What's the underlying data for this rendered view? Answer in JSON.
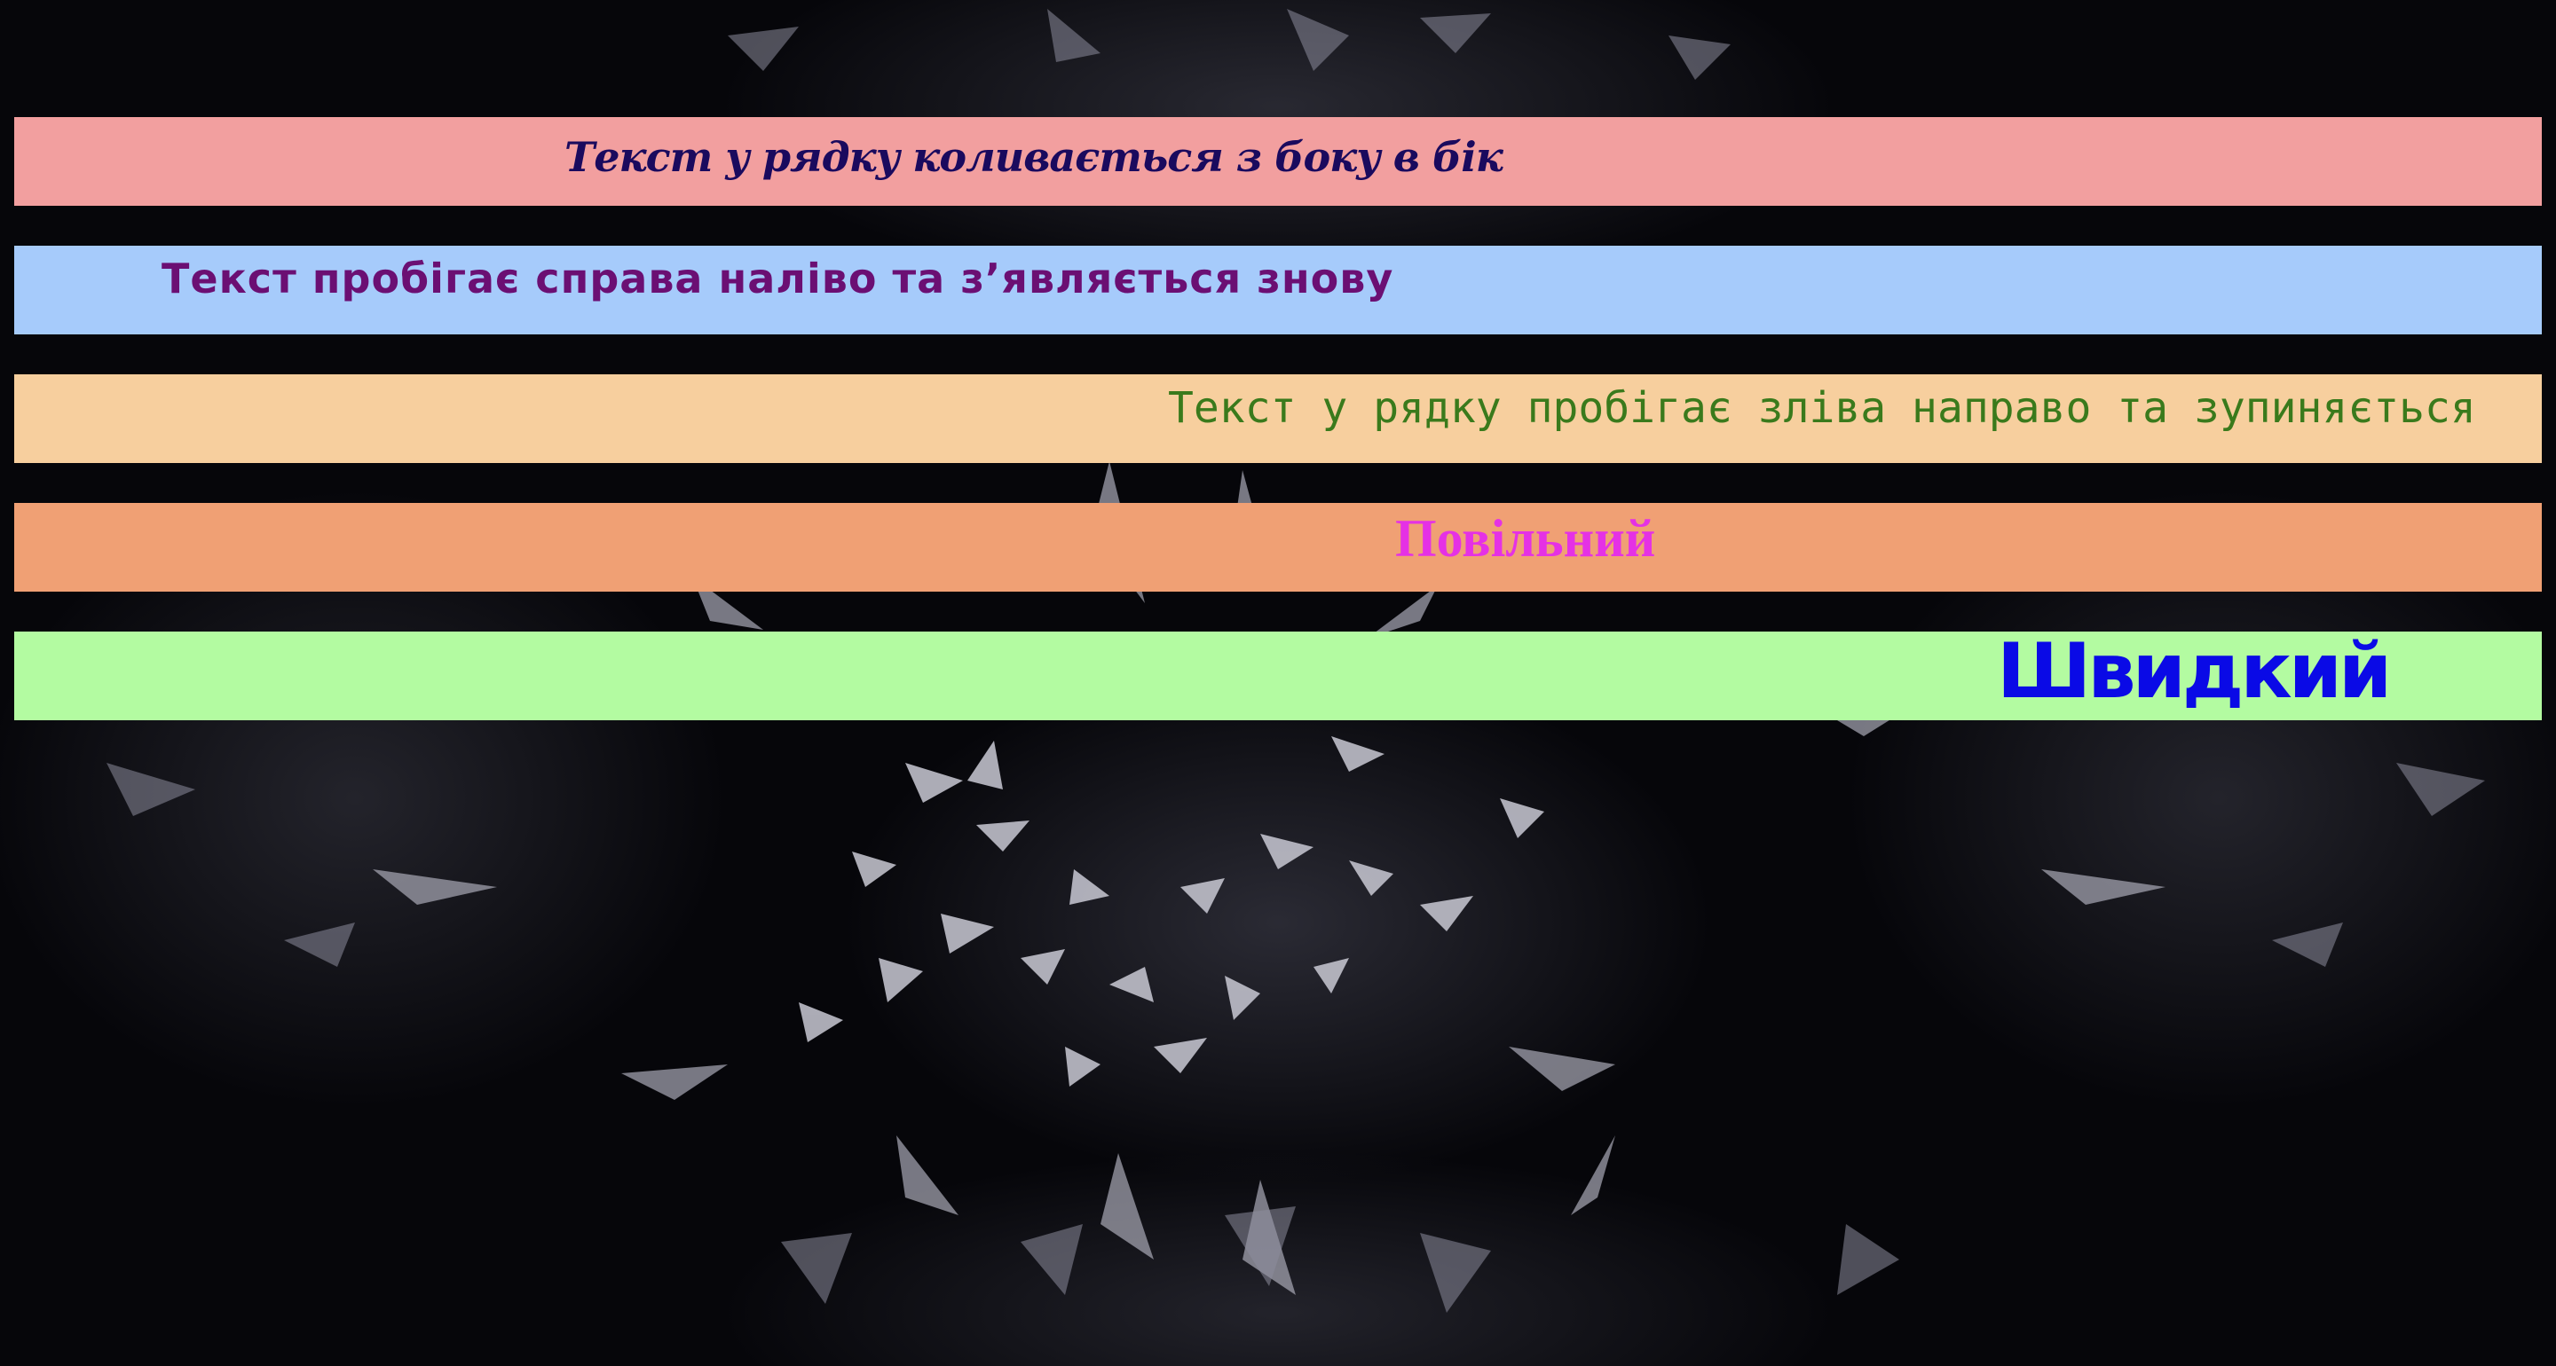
{
  "marquees": [
    {
      "text": "Текст у рядку коливається з боку в бік",
      "background": "#f29f9f",
      "color": "#1a0a5e"
    },
    {
      "text": "Текст пробігає справа наліво та з’являється знову",
      "background": "#a6cbfb",
      "color": "#6b0f73"
    },
    {
      "text": "Текст у рядку пробігає зліва направо та зупиняється",
      "background": "#f7cf9e",
      "color": "#3a7a1c"
    },
    {
      "text": "Повільний",
      "background": "#f0a074",
      "color": "#e531e5"
    },
    {
      "text": "Швидкий",
      "background": "#b3fba1",
      "color": "#0a0ae6"
    }
  ],
  "background": {
    "image": "shattered-glass-background",
    "color": "#06060a"
  }
}
